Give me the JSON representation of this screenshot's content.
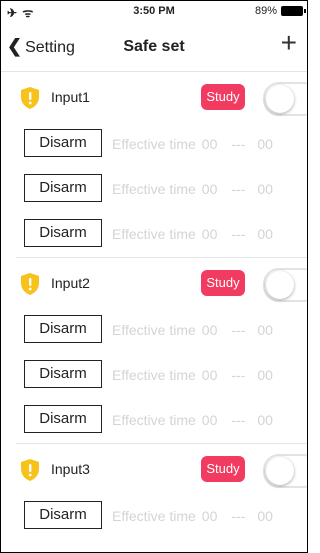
{
  "status_bar": {
    "signal": "✈ ᯤ",
    "time": "3:50 PM",
    "battery_percent": "89%"
  },
  "nav": {
    "back_label": "Setting",
    "title": "Safe set",
    "add_symbol": "+"
  },
  "colors": {
    "study_button": "#f23b61",
    "shield": "#f7c21b",
    "effective_text": "#d4d4d4"
  },
  "inputs": [
    {
      "label": "Input1",
      "study_label": "Study",
      "enabled": false,
      "times": [
        {
          "disarm_label": "Disarm",
          "effective_label": "Effective time",
          "start": "00",
          "separator": "---",
          "end": "00"
        },
        {
          "disarm_label": "Disarm",
          "effective_label": "Effective time",
          "start": "00",
          "separator": "---",
          "end": "00"
        },
        {
          "disarm_label": "Disarm",
          "effective_label": "Effective time",
          "start": "00",
          "separator": "---",
          "end": "00"
        }
      ]
    },
    {
      "label": "Input2",
      "study_label": "Study",
      "enabled": false,
      "times": [
        {
          "disarm_label": "Disarm",
          "effective_label": "Effective time",
          "start": "00",
          "separator": "---",
          "end": "00"
        },
        {
          "disarm_label": "Disarm",
          "effective_label": "Effective time",
          "start": "00",
          "separator": "---",
          "end": "00"
        },
        {
          "disarm_label": "Disarm",
          "effective_label": "Effective time",
          "start": "00",
          "separator": "---",
          "end": "00"
        }
      ]
    },
    {
      "label": "Input3",
      "study_label": "Study",
      "enabled": false,
      "times": [
        {
          "disarm_label": "Disarm",
          "effective_label": "Effective time",
          "start": "00",
          "separator": "---",
          "end": "00"
        }
      ]
    }
  ]
}
